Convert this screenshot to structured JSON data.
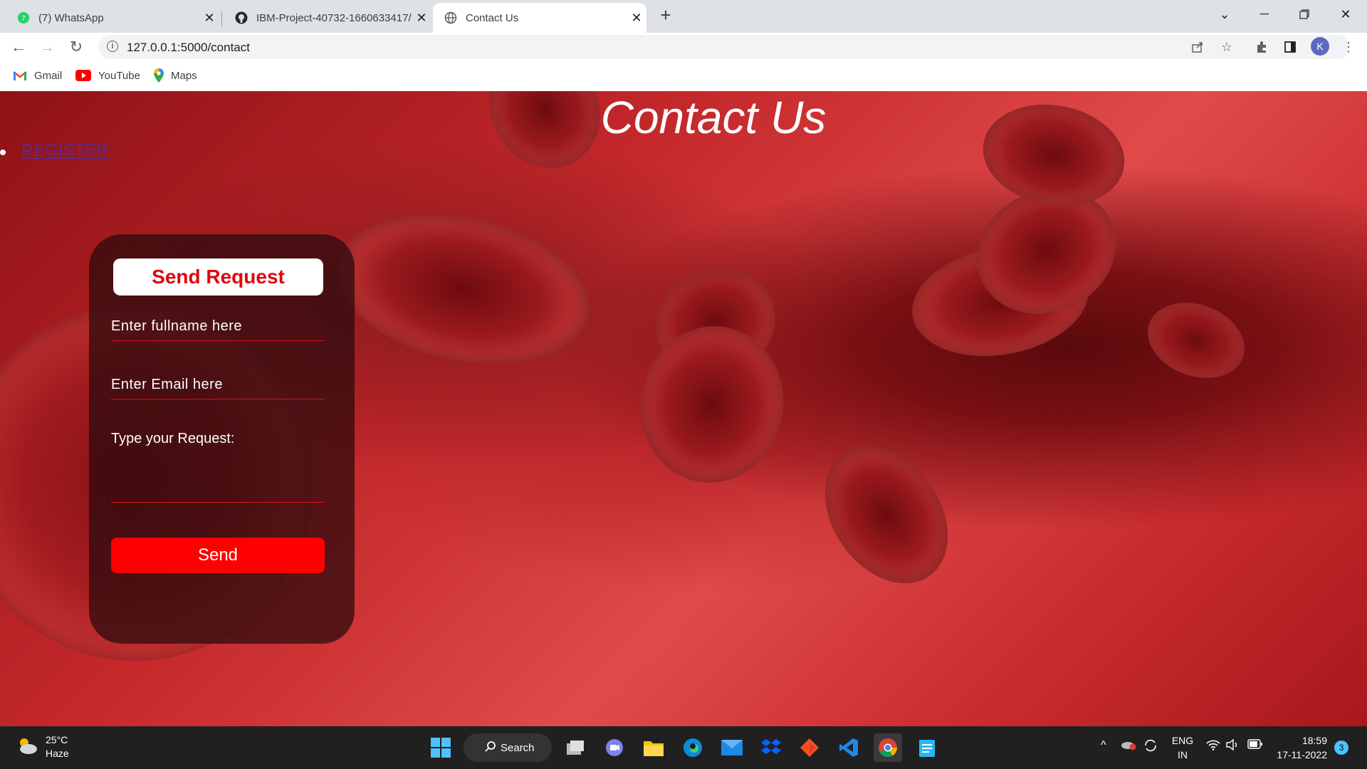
{
  "browser": {
    "tabs": [
      {
        "title": "(7) WhatsApp",
        "icon": "whatsapp-icon"
      },
      {
        "title": "IBM-Project-40732-1660633417/",
        "icon": "github-icon"
      },
      {
        "title": "Contact Us",
        "icon": "globe-icon",
        "active": true
      }
    ],
    "url": "127.0.0.1:5000/contact",
    "avatar_letter": "K",
    "bookmarks": [
      {
        "label": "Gmail",
        "icon": "gmail-icon"
      },
      {
        "label": "YouTube",
        "icon": "youtube-icon"
      },
      {
        "label": "Maps",
        "icon": "maps-icon"
      }
    ]
  },
  "page": {
    "title": "Contact Us",
    "nav_link": "REGISTER",
    "form": {
      "heading": "Send Request",
      "fullname_placeholder": "Enter fullname here",
      "email_placeholder": "Enter Email here",
      "request_label": "Type your Request:",
      "send_label": "Send"
    },
    "colors": {
      "accent": "#ff0000",
      "heading_text": "#e0050d"
    }
  },
  "taskbar": {
    "weather_temp": "25°C",
    "weather_desc": "Haze",
    "search_label": "Search",
    "lang_top": "ENG",
    "lang_bottom": "IN",
    "time": "18:59",
    "date": "17-11-2022",
    "notification_count": "3"
  }
}
